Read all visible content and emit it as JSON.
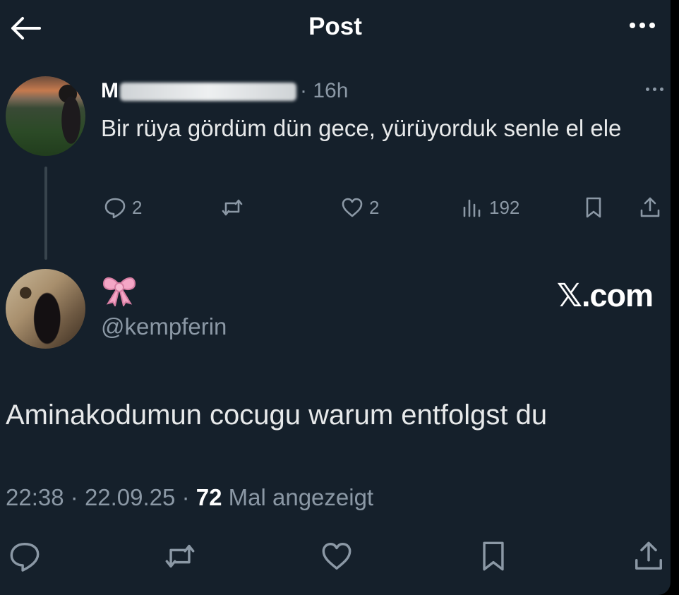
{
  "header": {
    "title": "Post",
    "back_icon": "arrow-left-icon",
    "more_icon": "more-horizontal-icon"
  },
  "parent_post": {
    "author_initial": "M",
    "time": "· 16h",
    "text": "Bir rüya gördüm dün gece, yürüyorduk senle el ele",
    "stats": {
      "replies": "2",
      "reposts": "",
      "likes": "2",
      "views": "192"
    }
  },
  "main_post": {
    "display_name_icon": "pink-bow-icon",
    "handle": "@kempferin",
    "watermark": "𝕏.com",
    "text": "Aminakodumun cocugu warum entfolgst du",
    "meta": {
      "time": "22:38",
      "date": "22.09.25",
      "views_count": "72",
      "views_label": "Mal angezeigt"
    }
  },
  "colors": {
    "background": "#15202b",
    "text": "#e7e9ea",
    "muted": "#8b98a5",
    "thread_line": "#38444d",
    "bow": "#f4a6c6"
  }
}
